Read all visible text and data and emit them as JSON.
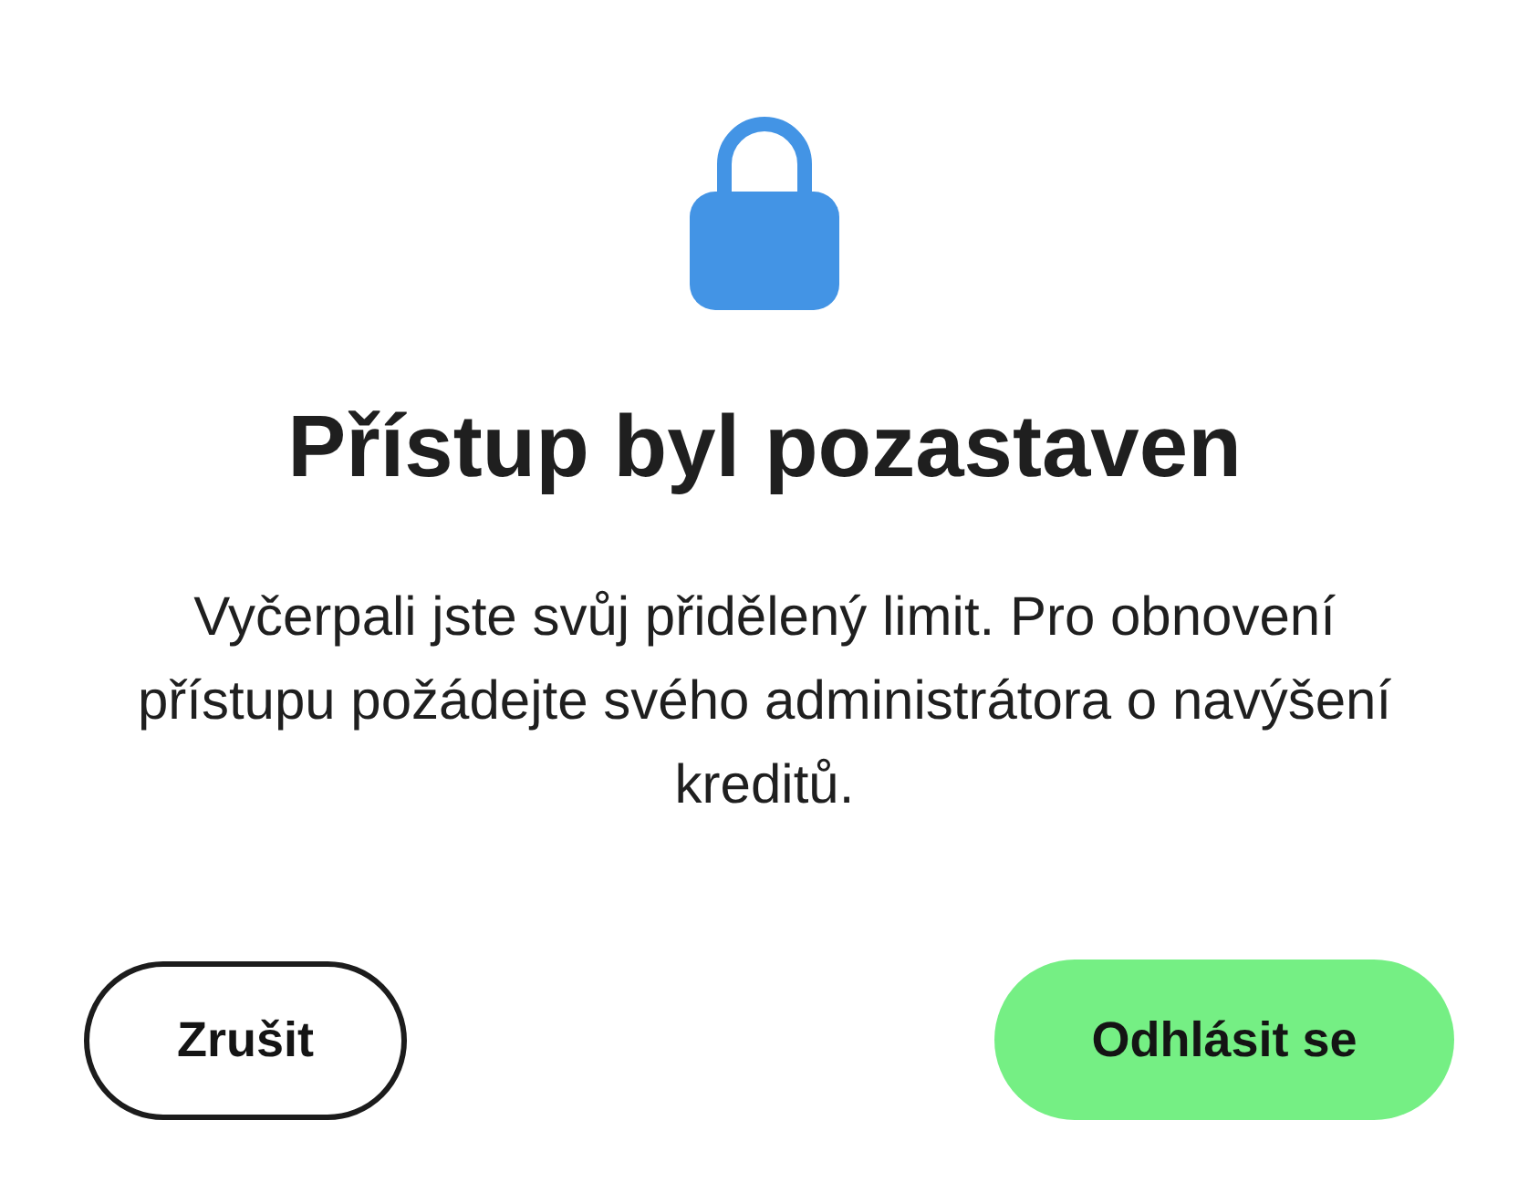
{
  "dialog": {
    "title": "Přístup byl pozastaven",
    "message": "Vyčerpali jste svůj přidělený limit. Pro obnovení přístupu požádejte svého administrátora o navýšení kreditů."
  },
  "buttons": [
    {
      "label": "Zrušit",
      "kind": "secondary"
    },
    {
      "label": "Odhlásit se",
      "kind": "primary"
    }
  ]
}
